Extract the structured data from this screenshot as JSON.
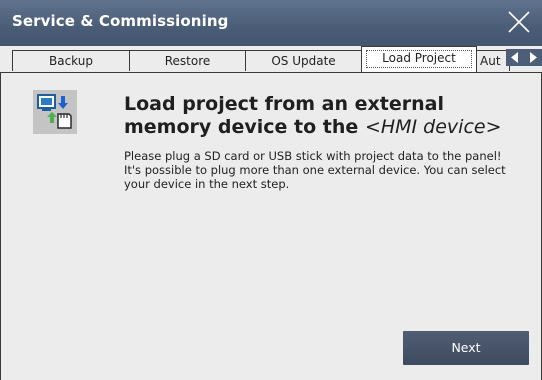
{
  "window": {
    "title": "Service & Commissioning"
  },
  "tabs": [
    {
      "label": "Backup"
    },
    {
      "label": "Restore"
    },
    {
      "label": "OS Update"
    },
    {
      "label": "Load Project",
      "active": true
    },
    {
      "label": "Aut"
    }
  ],
  "page": {
    "heading_main": "Load project from an external memory device to the",
    "heading_device": "<HMI device>",
    "paragraph1": "Please plug a SD card or USB stick with project data to the panel!",
    "paragraph2": "It's possible to plug more than one external device. You can select your device in the next step.",
    "next_label": "Next"
  },
  "icons": {
    "close": "close-icon",
    "tab_left": "chevron-left-icon",
    "tab_right": "chevron-right-icon",
    "info": "load-project-icon"
  },
  "colors": {
    "titlebar": "#4a5c76",
    "button": "#444f63",
    "background": "#ececec"
  }
}
